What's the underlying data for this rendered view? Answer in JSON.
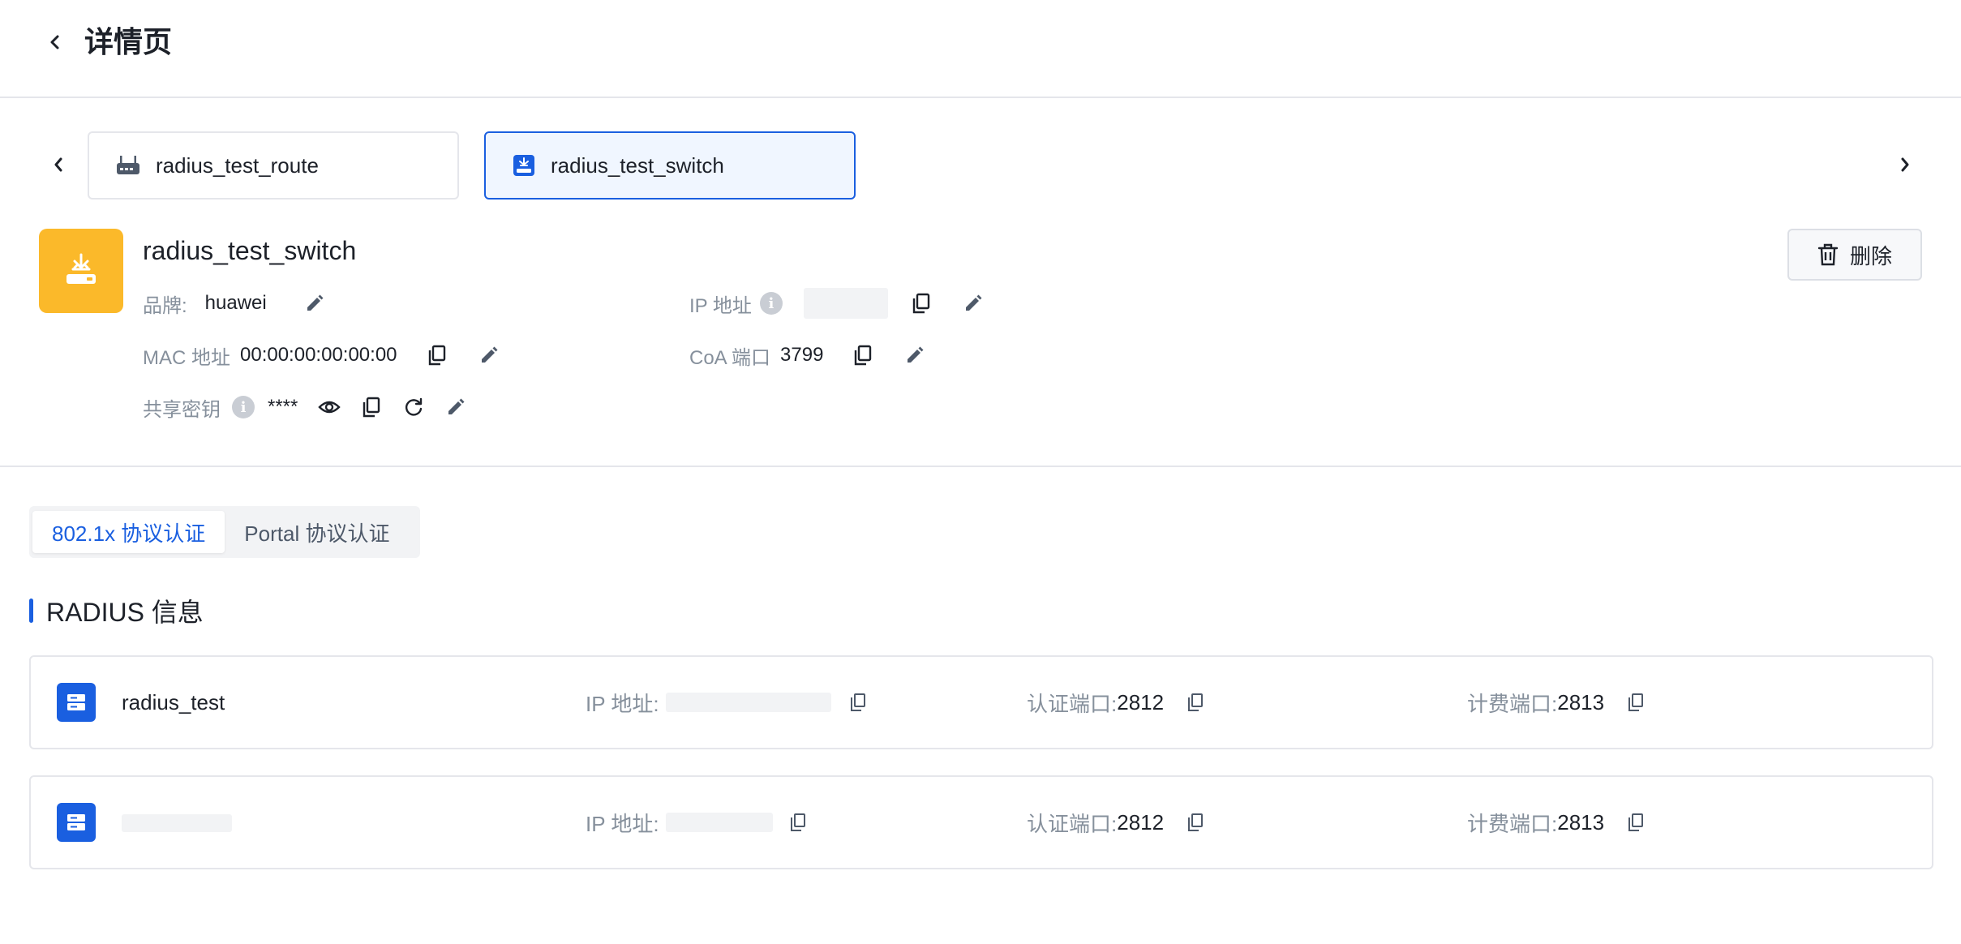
{
  "header": {
    "title": "详情页"
  },
  "device_tabs": [
    {
      "label": "radius_test_route",
      "icon": "router-icon",
      "active": false
    },
    {
      "label": "radius_test_switch",
      "icon": "switch-icon",
      "active": true
    }
  ],
  "device": {
    "name": "radius_test_switch",
    "brand_label": "品牌:",
    "brand_value": "huawei",
    "ip_label": "IP 地址",
    "mac_label": "MAC 地址",
    "mac_value": "00:00:00:00:00:00",
    "coa_label": "CoA 端口",
    "coa_value": "3799",
    "secret_label": "共享密钥",
    "secret_value": "****",
    "delete_label": "删除",
    "avatar_color": "#fbb92a"
  },
  "protocol_tabs": [
    {
      "label": "802.1x 协议认证",
      "active": true
    },
    {
      "label": "Portal 协议认证",
      "active": false
    }
  ],
  "radius_section": {
    "title": "RADIUS 信息",
    "servers": [
      {
        "name": "radius_test",
        "ip_label": "IP 地址:",
        "auth_label": "认证端口:",
        "auth_port": "2812",
        "acct_label": "计费端口:",
        "acct_port": "2813"
      },
      {
        "name": "",
        "ip_label": "IP 地址:",
        "auth_label": "认证端口:",
        "auth_port": "2812",
        "acct_label": "计费端口:",
        "acct_port": "2813"
      }
    ]
  },
  "colors": {
    "accent": "#1a5fe0",
    "muted": "#86909c",
    "border": "#e5e6eb"
  }
}
